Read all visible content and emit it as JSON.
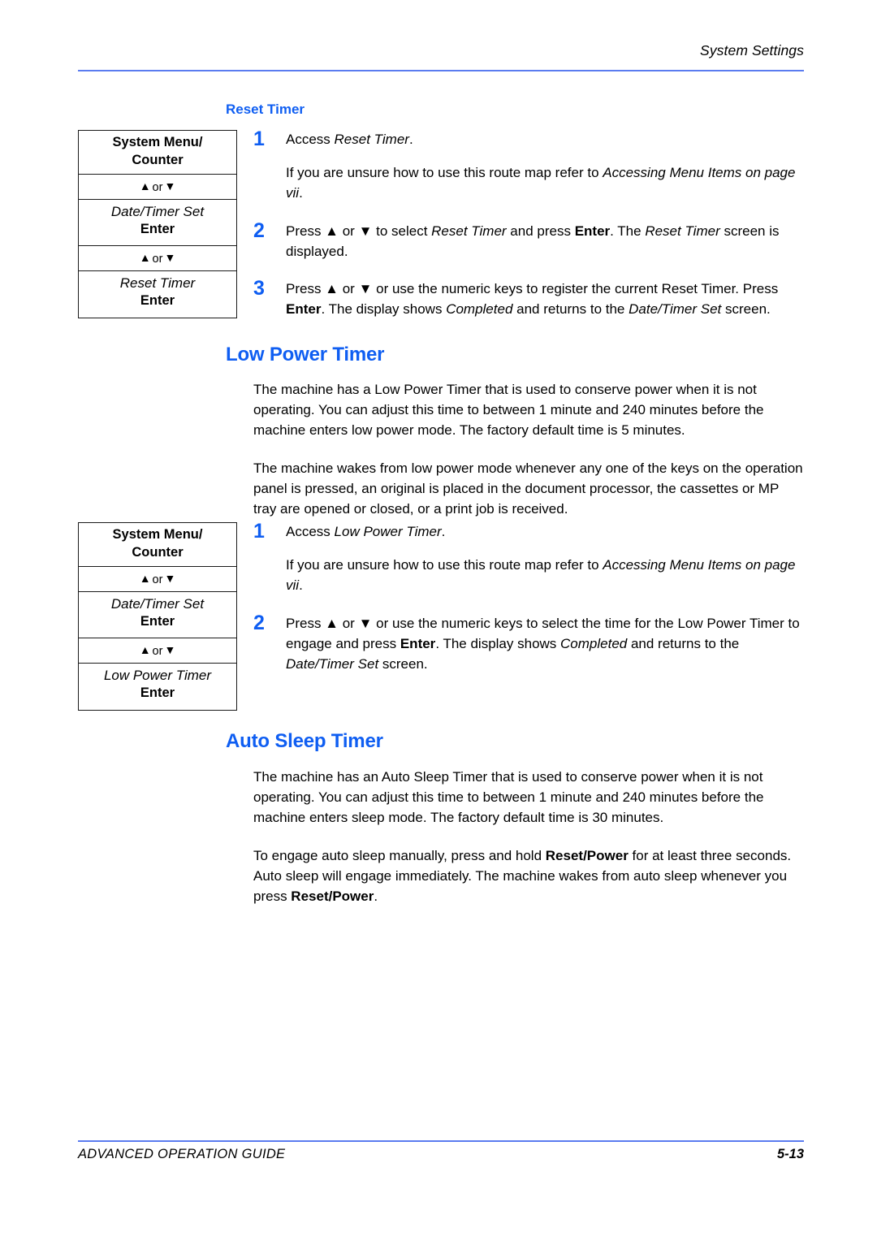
{
  "header": {
    "title": "System Settings"
  },
  "footer": {
    "guide_label": "ADVANCED OPERATION GUIDE",
    "page_number": "5-13"
  },
  "colors": {
    "accent_blue": "#0f5ef2",
    "rule_blue": "#5b7cf0",
    "text_black": "#000000"
  },
  "icons": {
    "up_arrow": "▲",
    "down_arrow": "▼",
    "or_word": "or"
  },
  "sections": [
    {
      "id": "reset-timer",
      "heading": "Reset Timer",
      "heading_level": "sub",
      "routemap": {
        "rows": [
          {
            "type": "key",
            "text": "System Menu/\nCounter"
          },
          {
            "type": "arrows",
            "text": "▲ or ▼"
          },
          {
            "type": "menu",
            "item": "Date/Timer Set",
            "key": "Enter"
          },
          {
            "type": "arrows",
            "text": "▲ or ▼"
          },
          {
            "type": "menu",
            "item": "Reset Timer",
            "key": "Enter"
          }
        ]
      },
      "steps": [
        {
          "number": "1",
          "paragraphs": [
            "Access <i>Reset Timer</i>.",
            "If you are unsure how to use this route map refer to <i>Accessing Menu Items on page vii</i>."
          ]
        },
        {
          "number": "2",
          "paragraphs": [
            "Press ▲ or ▼ to select <i>Reset Timer</i> and press <b>Enter</b>. The <i>Reset Timer</i> screen is displayed."
          ]
        },
        {
          "number": "3",
          "paragraphs": [
            "Press ▲ or ▼ or use the numeric keys to register the current Reset Timer. Press <b>Enter</b>. The display shows <i>Completed</i> and returns to the <i>Date/Timer Set</i> screen."
          ]
        }
      ]
    },
    {
      "id": "low-power-timer",
      "heading": "Low Power Timer",
      "heading_level": "section",
      "intro_paragraphs": [
        "The machine has a Low Power Timer that is used to conserve power when it is not operating. You can adjust this time to between 1 minute and 240 minutes before the machine enters low power mode. The factory default time is 5 minutes.",
        "The machine wakes from low power mode whenever any one of the keys on the operation panel is pressed, an original is placed in the document processor, the cassettes or MP tray are opened or closed, or a print job is received."
      ],
      "routemap": {
        "rows": [
          {
            "type": "key",
            "text": "System Menu/\nCounter"
          },
          {
            "type": "arrows",
            "text": "▲ or ▼"
          },
          {
            "type": "menu",
            "item": "Date/Timer Set",
            "key": "Enter"
          },
          {
            "type": "arrows",
            "text": "▲ or ▼"
          },
          {
            "type": "menu",
            "item": "Low Power Timer",
            "key": "Enter"
          }
        ]
      },
      "steps": [
        {
          "number": "1",
          "paragraphs": [
            "Access <i>Low Power Timer</i>.",
            "If you are unsure how to use this route map refer to <i>Accessing Menu Items on page vii</i>."
          ]
        },
        {
          "number": "2",
          "paragraphs": [
            "Press ▲ or ▼ or use the numeric keys to select the time for the Low Power Timer to engage and press <b>Enter</b>. The display shows <i>Completed</i> and returns to the <i>Date/Timer Set</i> screen."
          ]
        }
      ]
    },
    {
      "id": "auto-sleep-timer",
      "heading": "Auto Sleep Timer",
      "heading_level": "section",
      "intro_paragraphs": [
        "The machine has an Auto Sleep Timer that is used to conserve power when it is not operating. You can adjust this time to between 1 minute and 240 minutes before the machine enters sleep mode. The factory default time is 30 minutes.",
        "To engage auto sleep manually, press and hold <b>Reset/Power</b> for at least three seconds. Auto sleep will engage immediately. The machine wakes from auto sleep whenever you press <b>Reset/Power</b>."
      ]
    }
  ]
}
